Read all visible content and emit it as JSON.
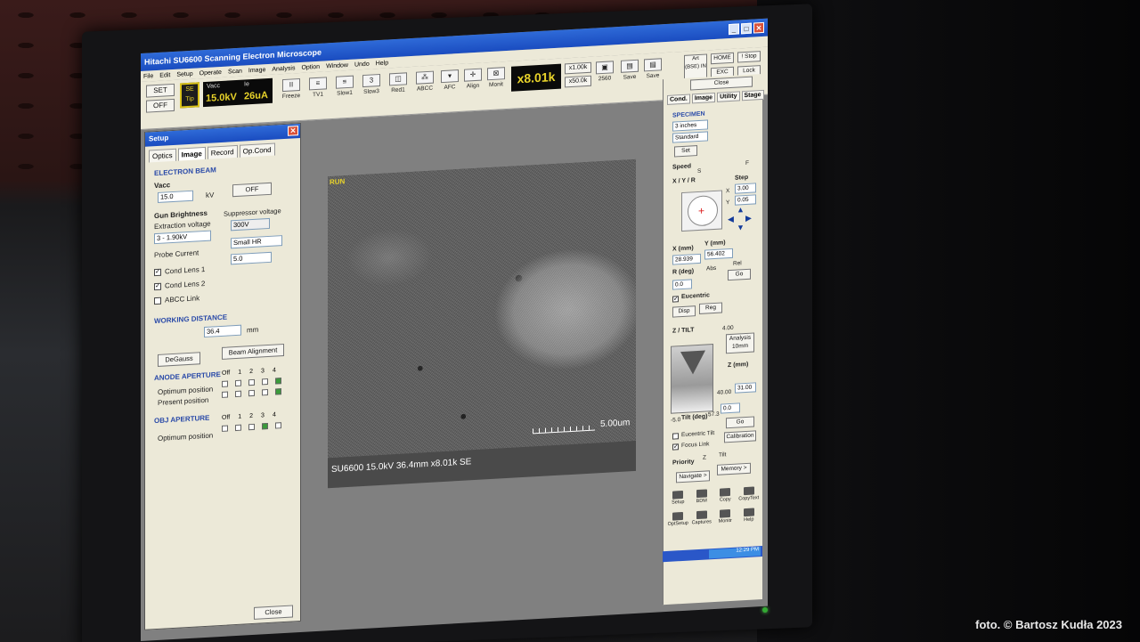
{
  "window": {
    "title": "Hitachi SU6600 Scanning Electron Microscope",
    "controls": [
      "_",
      "□",
      "✕"
    ]
  },
  "menu": [
    "File",
    "Edit",
    "Setup",
    "Operate",
    "Scan",
    "Image",
    "Analysis",
    "Option",
    "Window",
    "Undo",
    "Help"
  ],
  "toolbar": {
    "set_label": "SET",
    "off_label": "OFF",
    "se_tip": [
      "SE",
      "Tip"
    ],
    "vacc_label": "Vacc",
    "ie_label": "Ie",
    "vacc_value": "15.0kV",
    "ie_value": "26uA",
    "freeze_label": "Freeze",
    "tv1_label": "TV1",
    "slow1_label": "Slow1",
    "slow3_label": "Slow3",
    "red1_label": "Red1",
    "abcc_label": "ABCC",
    "afc_label": "AFC",
    "align_label": "Align",
    "monit_label": "Monit",
    "magnification": "x8.01k",
    "mag_low": "x1.00k",
    "mag_high": "x50.0k",
    "res_label": "2560",
    "save1_label": "Save",
    "save2_label": "Save",
    "art_bse_label": "Art (BSE) IN",
    "home_label": "HOME",
    "exc_label": "EXC",
    "stop_label": "! Stop",
    "lock_label": "Lock"
  },
  "setup": {
    "title": "Setup",
    "close_icon": "close-icon",
    "tabs": [
      "Optics",
      "Image",
      "Record",
      "Op.Cond"
    ],
    "electron_beam": "ELECTRON BEAM",
    "vacc_label": "Vacc",
    "vacc_value": "15.0",
    "vacc_unit": "kV",
    "off_button": "OFF",
    "gun_brightness": "Gun Brightness",
    "extraction_voltage": "Extraction voltage",
    "extraction_value": "3 - 1.90kV",
    "suppressor_voltage": "Suppressor voltage",
    "suppressor_value": "300V",
    "probe_current": "Probe Current",
    "probe_mode": "Small HR",
    "probe_value": "5.0",
    "cond_lens_1": "Cond Lens 1",
    "cond_lens_2": "Cond Lens 2",
    "abcc_link": "ABCC Link",
    "working_distance": "WORKING DISTANCE",
    "wd_value": "36.4",
    "wd_unit": "mm",
    "degauss": "DeGauss",
    "beam_alignment": "Beam Alignment",
    "anode_aperture": "ANODE APERTURE",
    "optimum_position": "Optimum position",
    "present_position": "Present position",
    "obj_aperture": "OBJ APERTURE",
    "obj_optimum_position": "Optimum position",
    "aperture_cols": [
      "Off",
      "1",
      "2",
      "3",
      "4"
    ],
    "close_button": "Close"
  },
  "image_view": {
    "status": "RUN",
    "scale_label": "5.00um",
    "caption": "SU6600 15.0kV 36.4mm x8.01k SE"
  },
  "right_panel": {
    "close_button": "Close",
    "tabs": [
      "Cond.",
      "Image",
      "Utility",
      "Stage"
    ],
    "specimen": "SPECIMEN",
    "size_value": "3 inches",
    "holder_value": "Standard",
    "set_button": "Set",
    "speed_label": "Speed",
    "speed_s": "S",
    "speed_f": "F",
    "xyr_label": "X / Y / R",
    "step_label": "Step",
    "step_x": "3.00",
    "step_y": "0.05",
    "x_label": "X",
    "y_label": "Y",
    "x_mm_label": "X (mm)",
    "y_mm_label": "Y (mm)",
    "x_value": "28.939",
    "y_value": "56.402",
    "r_label": "R (deg)",
    "abs_label": "Abs",
    "rel_label": "Rel",
    "r_value": "0.0",
    "go_button": "Go",
    "eucentric": "Eucentric",
    "disp_button": "Disp",
    "reg_button": "Reg",
    "z_tilt": "Z / TILT",
    "z_top": "4.00",
    "analysis_button": "Analysis 10mm",
    "z_mm_label": "Z (mm)",
    "z_max": "40.00",
    "z_value": "31.00",
    "tilt_min": "-5.0",
    "tilt_label": "Tilt (deg)",
    "tilt_max": "57.3",
    "tilt_value": "0.0",
    "eucentric_tilt": "Eucentric Tilt",
    "go2_button": "Go",
    "focus_link": "Focus Link",
    "calibration_button": "Calibration",
    "priority_label": "Priority",
    "priority_z": "Z",
    "priority_tilt": "Tilt",
    "navigate_button": "Navigate >",
    "memory_button": "Memory >",
    "bottom_icons": [
      "Setup",
      "BDM",
      "Copy",
      "CopyText",
      "OptSetup",
      "Captures",
      "Monitr",
      "Help"
    ],
    "clock": "12:29 PM"
  },
  "credit": "foto. © Bartosz Kudła 2023"
}
